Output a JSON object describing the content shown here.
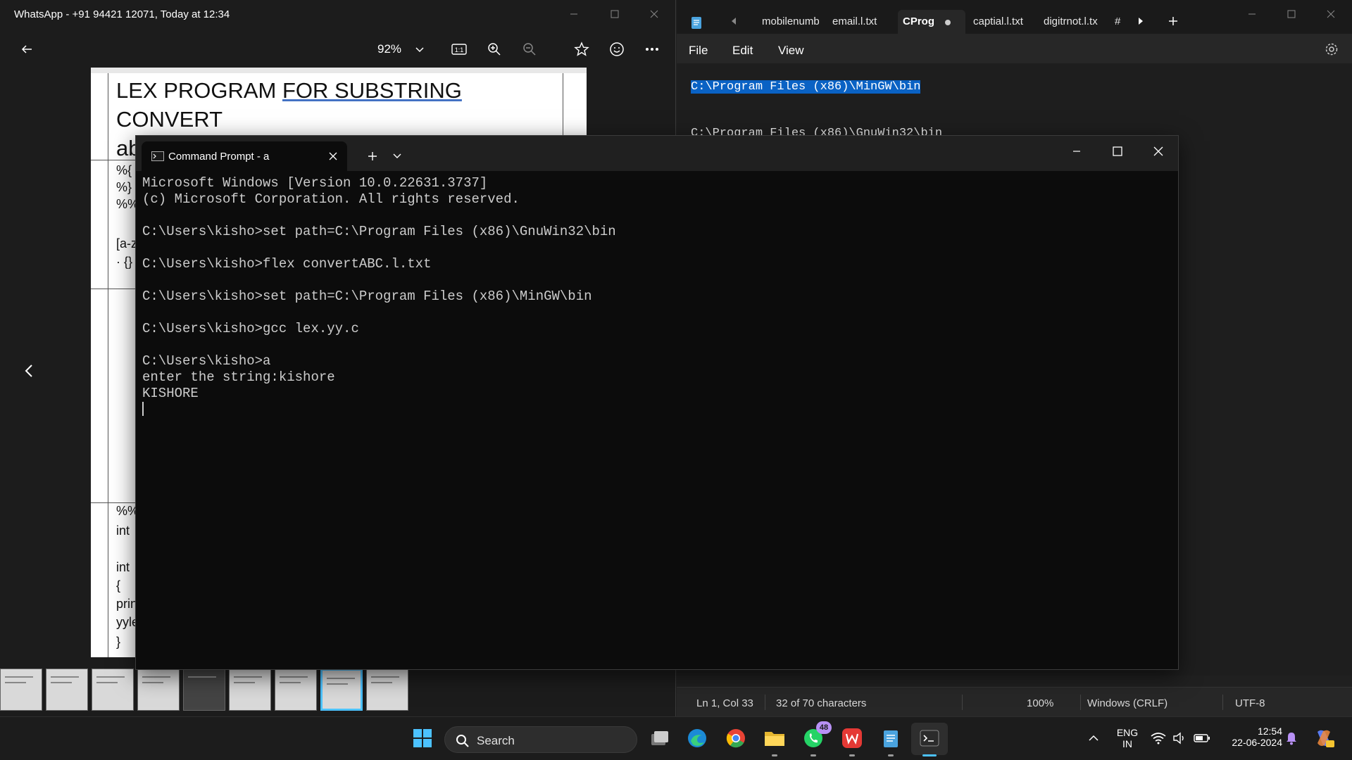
{
  "photo_viewer": {
    "title": "WhatsApp - +91 94421 12071, Today at 12:34",
    "zoom": "92%",
    "document": {
      "title_part1": "LEX PROGRAM ",
      "title_underlined": "FOR  SUBSTRING",
      "title_part2": " CONVERT",
      "title_line2": "abc to ABC",
      "visible_lines_top": [
        "%{",
        "%}",
        "%%",
        "[a-z",
        "· {}"
      ],
      "visible_lines_bottom": [
        "%%",
        "int",
        "int",
        "{",
        "prin",
        "yyle",
        "}"
      ]
    }
  },
  "notepad": {
    "tabs": [
      "mobilenumb",
      "email.l.txt",
      "CProg",
      "captial.l.txt",
      "digitrnot.l.tx",
      "#"
    ],
    "active_tab": "CProg",
    "menu": [
      "File",
      "Edit",
      "View"
    ],
    "lines": [
      "C:\\Program Files (x86)\\MinGW\\bin",
      "C:\\Program Files (x86)\\GnuWin32\\bin"
    ],
    "status": {
      "position": "Ln 1, Col 33",
      "selection": "32 of 70 characters",
      "zoom": "100%",
      "line_ending": "Windows (CRLF)",
      "encoding": "UTF-8"
    }
  },
  "terminal": {
    "tab_title": "Command Prompt - a",
    "lines": [
      "Microsoft Windows [Version 10.0.22631.3737]",
      "(c) Microsoft Corporation. All rights reserved.",
      "",
      "C:\\Users\\kisho>set path=C:\\Program Files (x86)\\GnuWin32\\bin",
      "",
      "C:\\Users\\kisho>flex convertABC.l.txt",
      "",
      "C:\\Users\\kisho>set path=C:\\Program Files (x86)\\MinGW\\bin",
      "",
      "C:\\Users\\kisho>gcc lex.yy.c",
      "",
      "C:\\Users\\kisho>a",
      "enter the string:kishore",
      "KISHORE"
    ]
  },
  "taskbar": {
    "search_label": "Search",
    "whatsapp_badge": "48",
    "language": "ENG",
    "region": "IN",
    "time": "12:54",
    "date": "22-06-2024"
  }
}
